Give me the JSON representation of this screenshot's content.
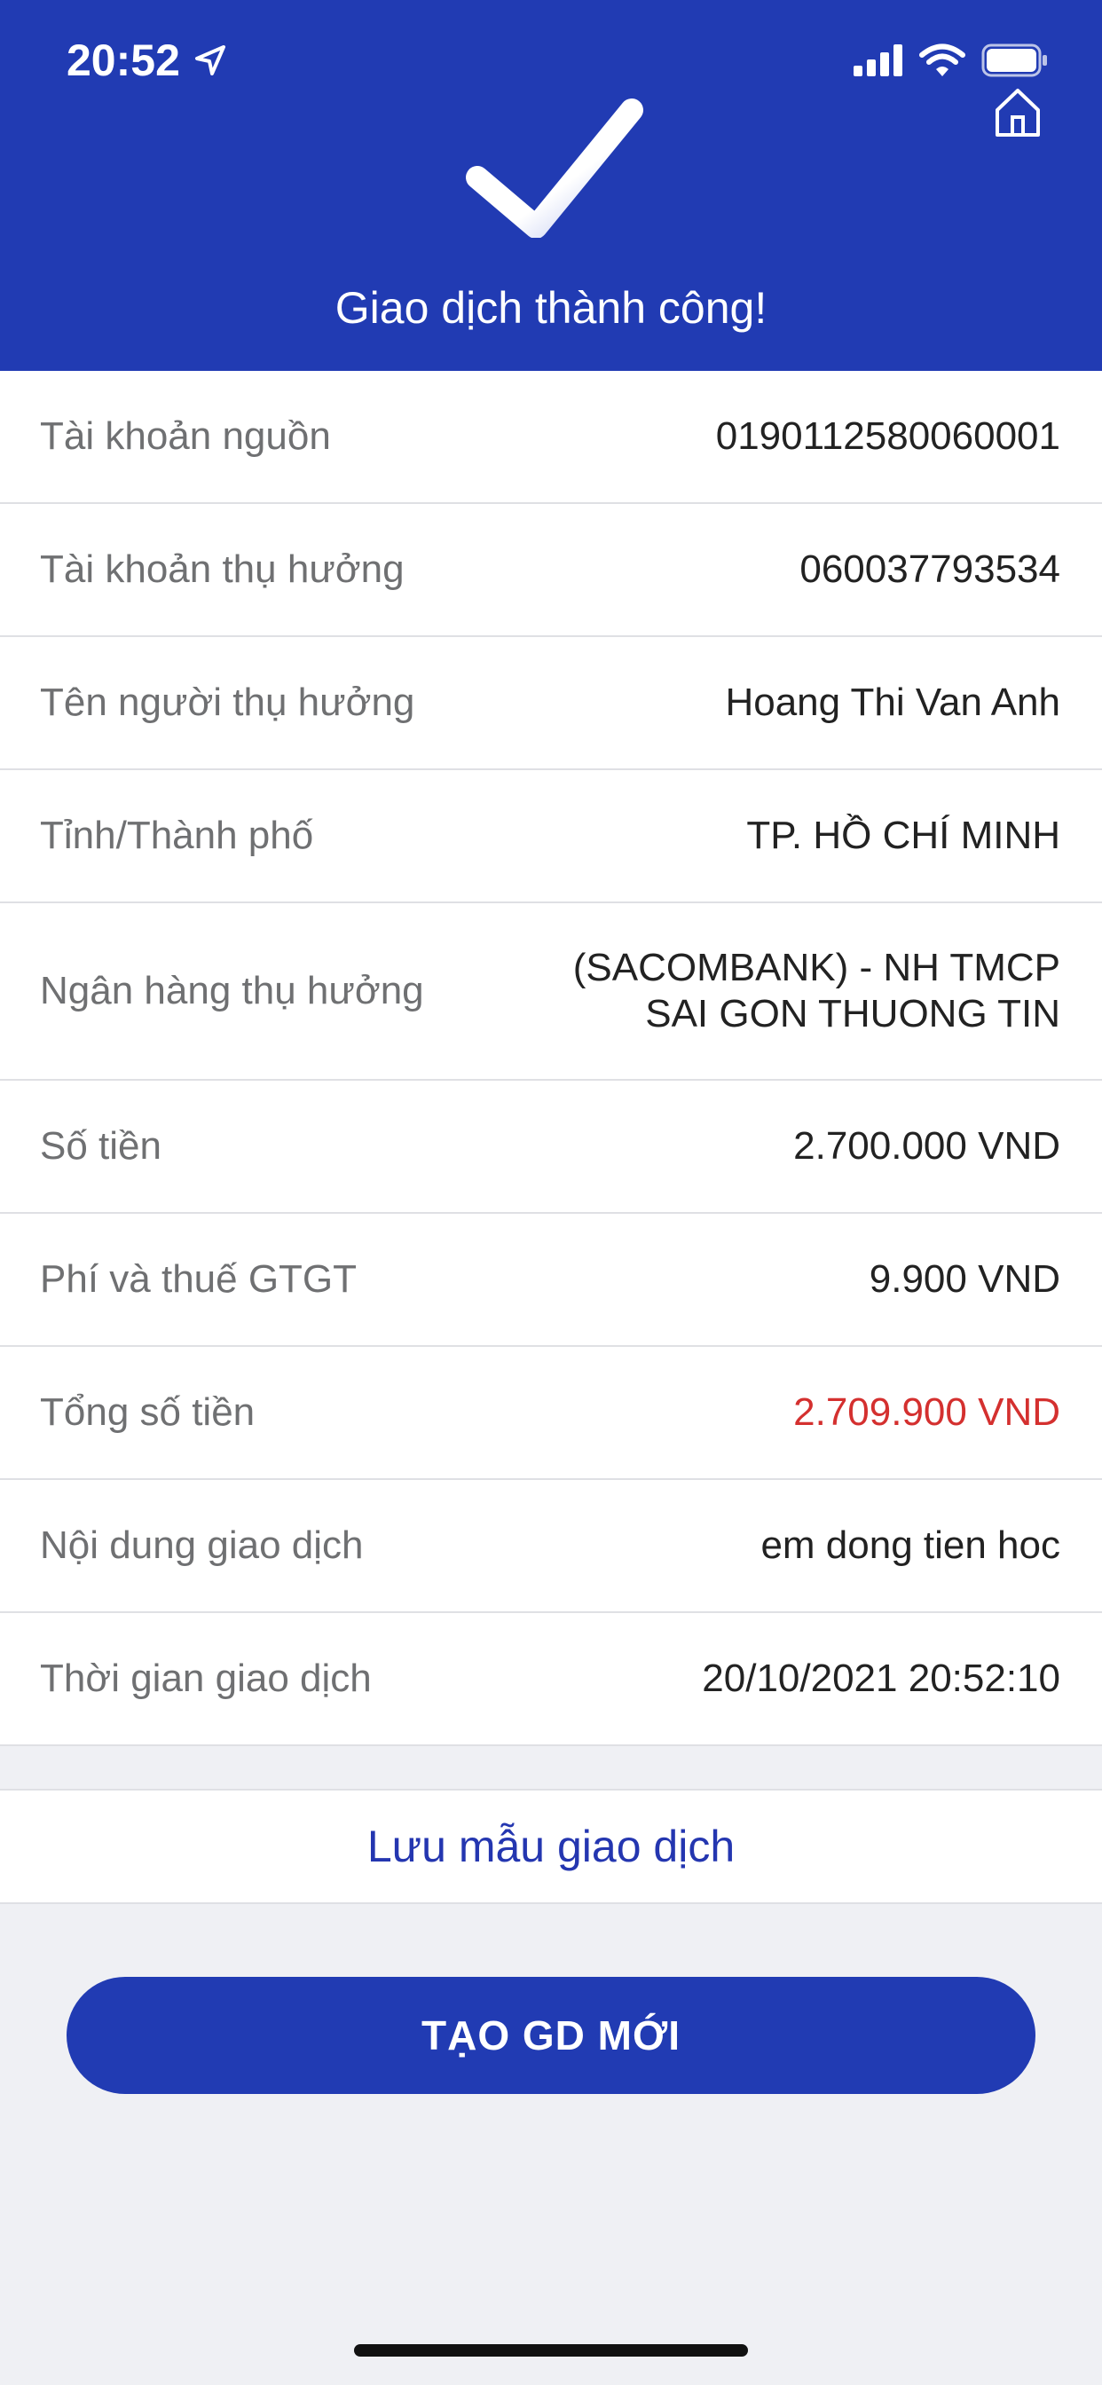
{
  "status_bar": {
    "time": "20:52"
  },
  "header": {
    "title": "Giao dịch thành công!"
  },
  "details": [
    {
      "label": "Tài khoản nguồn",
      "value": "0190112580060001"
    },
    {
      "label": "Tài khoản thụ hưởng",
      "value": "060037793534"
    },
    {
      "label": "Tên người thụ hưởng",
      "value": "Hoang Thi Van Anh"
    },
    {
      "label": "Tỉnh/Thành phố",
      "value": "TP. HỒ CHÍ MINH"
    },
    {
      "label": "Ngân hàng thụ hưởng",
      "value": "(SACOMBANK) - NH TMCP",
      "value2": "SAI GON THUONG TIN"
    },
    {
      "label": "Số tiền",
      "value": "2.700.000 VND"
    },
    {
      "label": "Phí và thuế GTGT",
      "value": "9.900 VND"
    },
    {
      "label": "Tổng số tiền",
      "value": "2.709.900 VND"
    },
    {
      "label": "Nội dung giao dịch",
      "value": "em dong tien hoc"
    },
    {
      "label": "Thời gian giao dịch",
      "value": "20/10/2021 20:52:10"
    }
  ],
  "actions": {
    "save_template": "Lưu mẫu giao dịch",
    "new_transaction": "TẠO GD MỚI"
  },
  "colors": {
    "primary": "#213bb3",
    "total_amount": "#d4302f",
    "background": "#eff0f4"
  }
}
